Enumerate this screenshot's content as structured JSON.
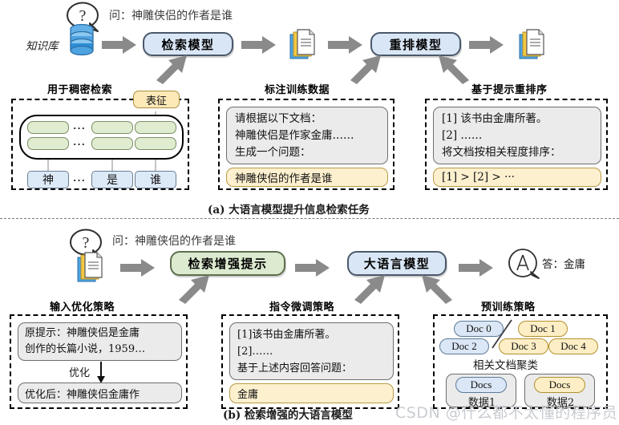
{
  "figure": {
    "watermark": "CSDN @什么都不太懂的程序员",
    "caption_a": "(a) 大语言模型提升信息检索任务",
    "caption_b": "(b) 检索增强的大语言模型"
  },
  "panel_a": {
    "question_prefix": "问：",
    "question": "问：神雕侠侣的作者是谁",
    "knowledge_base_label": "知识库",
    "knowledge_base_icon": "database-icon",
    "retriever_model": "检索模型",
    "reranker_model": "重排模型",
    "doc_icon": "documents-icon",
    "arrow_icon": "block-arrow-right-icon",
    "sections": [
      {
        "title": "用于稠密检索",
        "repr_label": "表征",
        "tokens": [
          "神",
          "是",
          "谁"
        ],
        "ellipsis": "···"
      },
      {
        "title": "标注训练数据",
        "prompt_lines": [
          "请根据以下文档：",
          "神雕侠侣是作家金庸……",
          "生成一个问题："
        ],
        "output": "神雕侠侣的作者是谁"
      },
      {
        "title": "基于提示重排序",
        "prompt_lines": [
          "[1] 该书由金庸所著。",
          "[2] ……",
          "将文档按相关程度排序："
        ],
        "output": "[1] > [2] > ···"
      }
    ]
  },
  "panel_b": {
    "question": "问：神雕侠侣的作者是谁",
    "doc_icon": "documents-icon",
    "rag_prompt_model": "检索增强提示",
    "llm_model": "大语言模型",
    "answer_icon": "answer-bubble-icon",
    "answer": "答：金庸",
    "sections": [
      {
        "title": "输入优化策略",
        "original_label": "原提示：",
        "original_lines": [
          "原提示：神雕侠侣是金庸",
          "创作的长篇小说，1959…"
        ],
        "arrow_label": "优化",
        "optimized": "优化后：神雕侠侣金庸作"
      },
      {
        "title": "指令微调策略",
        "prompt_lines": [
          "[1]该书由金庸所著。",
          "[2]……",
          "基于上述内容回答问题："
        ],
        "output": "金庸"
      },
      {
        "title": "预训练策略",
        "docs": [
          {
            "label": "Doc 0",
            "color": "blue"
          },
          {
            "label": "Doc 1",
            "color": "yellow"
          },
          {
            "label": "Doc 2",
            "color": "blue"
          },
          {
            "label": "Doc 3",
            "color": "yellow"
          },
          {
            "label": "Doc 4",
            "color": "yellow"
          }
        ],
        "cluster_label": "相关文档聚类",
        "clusters": [
          {
            "pill": "Docs",
            "name": "数据1",
            "color": "blue"
          },
          {
            "pill": "Docs",
            "name": "数据2",
            "color": "yellow"
          }
        ]
      }
    ]
  }
}
